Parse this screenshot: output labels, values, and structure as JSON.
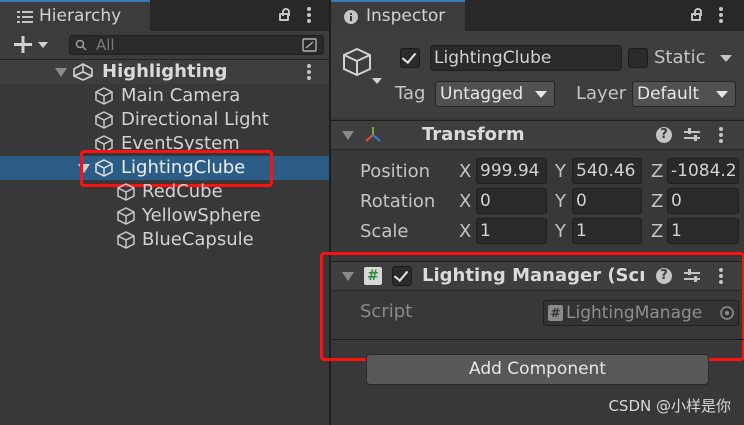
{
  "hierarchy": {
    "tab_title": "Hierarchy",
    "search_placeholder": "All",
    "scene_name": "Highlighting",
    "items": [
      {
        "label": "Main Camera"
      },
      {
        "label": "Directional Light"
      },
      {
        "label": "EventSystem"
      },
      {
        "label": "LightingClube",
        "selected": true
      },
      {
        "label": "RedCube"
      },
      {
        "label": "YellowSphere"
      },
      {
        "label": "BlueCapsule"
      }
    ]
  },
  "inspector": {
    "tab_title": "Inspector",
    "object_name": "LightingClube",
    "object_active": true,
    "static_label": "Static",
    "static_checked": false,
    "tag_label": "Tag",
    "tag_value": "Untagged",
    "layer_label": "Layer",
    "layer_value": "Default",
    "transform": {
      "title": "Transform",
      "rows": [
        {
          "label": "Position",
          "x": "999.94",
          "y": "540.46",
          "z": "-1084.2"
        },
        {
          "label": "Rotation",
          "x": "0",
          "y": "0",
          "z": "0"
        },
        {
          "label": "Scale",
          "x": "1",
          "y": "1",
          "z": "1"
        }
      ],
      "axis_x": "X",
      "axis_y": "Y",
      "axis_z": "Z"
    },
    "lighting_manager": {
      "title": "Lighting Manager (Scrip",
      "enabled": true,
      "script_label": "Script",
      "script_value": "LightingManage"
    },
    "add_component_label": "Add Component"
  },
  "icons": {
    "hierarchy_tab": "list-icon",
    "inspector_tab": "info-icon",
    "create": "plus-icon",
    "search": "search-icon",
    "scene": "unity-logo-icon",
    "gameobject": "cube-icon",
    "transform": "transform-axes-icon",
    "script": "script-hash-icon"
  },
  "colors": {
    "selection": "#2c5d87",
    "highlight_box": "#ff1010",
    "panel_bg": "#383838"
  },
  "watermark": "CSDN @小样是你"
}
